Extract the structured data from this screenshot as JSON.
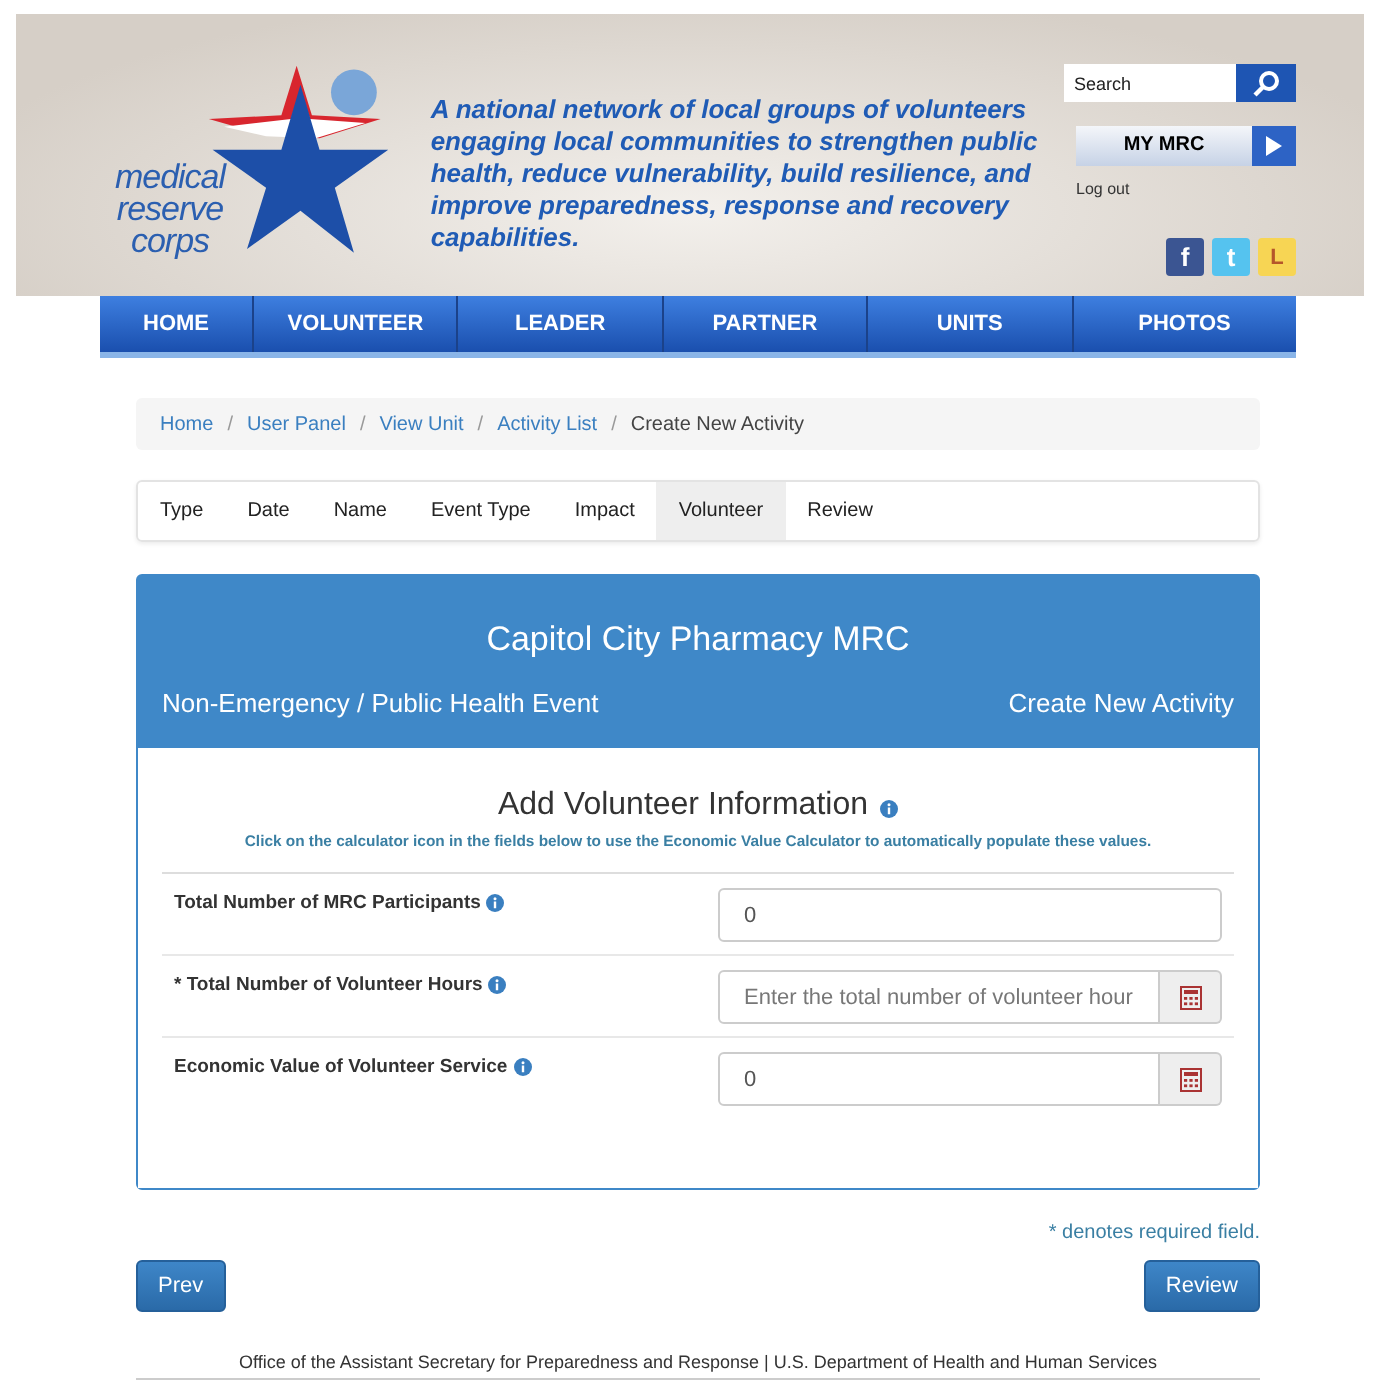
{
  "logo": {
    "lines": [
      "medical",
      "reserve",
      "corps"
    ]
  },
  "tagline": "A national network of local groups of volunteers engaging local communities to strengthen public health, reduce vulnerability, build resilience, and improve preparedness, response and recovery capabilities.",
  "search": {
    "placeholder": "Search"
  },
  "my_mrc": "MY MRC",
  "logout": "Log out",
  "social": [
    {
      "kind": "facebook",
      "label": "f"
    },
    {
      "kind": "twitter",
      "label": "t"
    },
    {
      "kind": "l",
      "label": "L"
    }
  ],
  "nav": [
    "HOME",
    "VOLUNTEER",
    "LEADER",
    "PARTNER",
    "UNITS",
    "PHOTOS"
  ],
  "breadcrumb": {
    "separator": "/",
    "items": [
      {
        "label": "Home",
        "current": false
      },
      {
        "label": "User Panel",
        "current": false
      },
      {
        "label": "View Unit",
        "current": false
      },
      {
        "label": "Activity List",
        "current": false
      },
      {
        "label": "Create New Activity",
        "current": true
      }
    ]
  },
  "steps": [
    {
      "label": "Type",
      "selected": false
    },
    {
      "label": "Date",
      "selected": false
    },
    {
      "label": "Name",
      "selected": false
    },
    {
      "label": "Event Type",
      "selected": false
    },
    {
      "label": "Impact",
      "selected": false
    },
    {
      "label": "Volunteer",
      "selected": true
    },
    {
      "label": "Review",
      "selected": false
    }
  ],
  "panel": {
    "title": "Capitol City Pharmacy MRC",
    "subtitle": "Non-Emergency / Public Health Event",
    "action": "Create New Activity"
  },
  "form": {
    "heading": "Add Volunteer Information",
    "hint": "Click on the calculator icon in the fields below to use the Economic Value Calculator to automatically populate these values.",
    "fields": [
      {
        "label": "Total Number of MRC Participants",
        "value": "0",
        "calculator": false
      },
      {
        "label": "* Total Number of Volunteer Hours",
        "placeholder": "Enter the total number of volunteer hour",
        "calculator": true
      },
      {
        "label": "Economic Value of Volunteer Service",
        "value": "0",
        "calculator": true
      }
    ]
  },
  "required_note": "* denotes required field.",
  "buttons": {
    "prev": "Prev",
    "next": "Review"
  },
  "footer": "Office of the Assistant Secretary for Preparedness and Response | U.S. Department of Health and Human Services"
}
